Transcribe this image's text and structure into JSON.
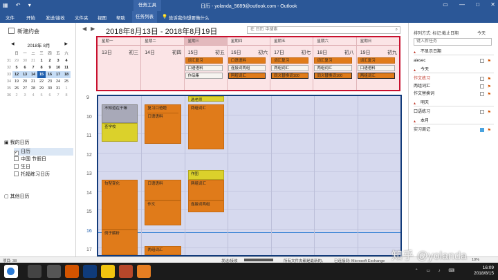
{
  "titlebar": {
    "context_tab": "任务工具",
    "window_title": "日历 - yolanda_5689@outlook.com - Outlook"
  },
  "ribbon": {
    "tabs": [
      "文件",
      "开始",
      "发送/接收",
      "文件夹",
      "视图",
      "帮助",
      "任务列表"
    ],
    "tell_me": "告诉我你想要做什么"
  },
  "left": {
    "new_appointment": "新建约会",
    "mini_cal_title": "2018年 8月",
    "dow": [
      "日",
      "一",
      "二",
      "三",
      "四",
      "五",
      "六"
    ],
    "weeks": [
      [
        "31",
        "29",
        "30",
        "31",
        "1",
        "2",
        "3",
        "4"
      ],
      [
        "32",
        "5",
        "6",
        "7",
        "8",
        "9",
        "10",
        "11"
      ],
      [
        "33",
        "12",
        "13",
        "14",
        "15",
        "16",
        "17",
        "18"
      ],
      [
        "34",
        "19",
        "20",
        "21",
        "22",
        "23",
        "24",
        "25"
      ],
      [
        "35",
        "26",
        "27",
        "28",
        "29",
        "30",
        "31",
        "1"
      ],
      [
        "36",
        "2",
        "3",
        "4",
        "5",
        "6",
        "7",
        "8"
      ]
    ],
    "my_calendars": "我的日历",
    "calendars": [
      "日历",
      "中国 节假日",
      "生日",
      "托福练习日历"
    ],
    "other_calendars": "其他日历"
  },
  "main": {
    "date_range": "2018年8月13日 - 2018年8月19日",
    "search_placeholder": "在 日历 中搜索",
    "days": [
      {
        "name": "星期一",
        "num": "13日",
        "lunar": "初三",
        "events": []
      },
      {
        "name": "星期二",
        "num": "14日",
        "lunar": "初四",
        "events": []
      },
      {
        "name": "星期三",
        "num": "15日",
        "lunar": "初五",
        "events": [
          "词汇复习",
          "口语语料",
          "作品集"
        ]
      },
      {
        "name": "星期四",
        "num": "16日",
        "lunar": "初六",
        "events": [
          "口语语料",
          "连接词两组",
          "阿纽词汇"
        ]
      },
      {
        "name": "星期五",
        "num": "17日",
        "lunar": "初七",
        "events": [
          "词汇复习",
          "两组词汇",
          "同义替换词100"
        ]
      },
      {
        "name": "星期六",
        "num": "18日",
        "lunar": "初八",
        "events": [
          "词汇复习",
          "两组词汇",
          "同义替换词100"
        ]
      },
      {
        "name": "星期日",
        "num": "19日",
        "lunar": "初九",
        "events": [
          "词汇复习",
          "口语语料",
          "两组词汇"
        ]
      }
    ],
    "hours": [
      "9",
      "10",
      "11",
      "12",
      "13",
      "14",
      "15",
      "16",
      "17"
    ],
    "grid_events": [
      {
        "label": "选老师",
        "day": 2,
        "start": 8.6,
        "end": 9.3,
        "color": "y"
      },
      {
        "label": "不知道在干嘛",
        "day": 0,
        "start": 9.45,
        "end": 10.4,
        "color": "g"
      },
      {
        "label": "查学校",
        "day": 0,
        "start": 10.4,
        "end": 11.4,
        "color": "y"
      },
      {
        "label": "复习口语题",
        "day": 1,
        "start": 9.45,
        "end": 11.5,
        "color": "o",
        "inner": "口语语料"
      },
      {
        "label": "两组词汇",
        "day": 2,
        "start": 9.45,
        "end": 11.8,
        "color": "o"
      },
      {
        "label": "作图",
        "day": 2,
        "start": 12.9,
        "end": 13.4,
        "color": "y"
      },
      {
        "label": "两组词汇",
        "day": 2,
        "start": 13.4,
        "end": 14.5,
        "color": "o"
      },
      {
        "label": "连接词两组",
        "day": 2,
        "start": 14.5,
        "end": 15.1,
        "color": "o"
      },
      {
        "label": "句型变化",
        "day": 0,
        "start": 13.4,
        "end": 16.0,
        "color": "o"
      },
      {
        "label": "口语语料",
        "day": 1,
        "start": 13.4,
        "end": 14.5,
        "color": "o"
      },
      {
        "label": "作文",
        "day": 1,
        "start": 14.5,
        "end": 15.8,
        "color": "o"
      },
      {
        "label": "例子解析",
        "day": 0,
        "start": 16.0,
        "end": 17.4,
        "color": "o"
      },
      {
        "label": "两组词汇",
        "day": 1,
        "start": 16.9,
        "end": 17.4,
        "color": "o"
      }
    ]
  },
  "right": {
    "sort_label": "排列方式: 标记:截止日期",
    "today_label": "今天",
    "new_task_placeholder": "键入新任务",
    "sections": [
      {
        "title": "不显示日期",
        "tasks": [
          {
            "label": "aiesec",
            "red": false
          }
        ]
      },
      {
        "title": "今天",
        "tasks": [
          {
            "label": "作文练习",
            "red": true
          },
          {
            "label": "两组词汇",
            "red": false
          },
          {
            "label": "作文替换词",
            "red": false
          }
        ]
      },
      {
        "title": "明天",
        "tasks": [
          {
            "label": "口语练习",
            "red": false
          }
        ]
      },
      {
        "title": "本月",
        "tasks": [
          {
            "label": "实习周记",
            "red": false
          }
        ]
      }
    ]
  },
  "statusbar": {
    "items_count": "项目: 38",
    "send_receive": "发送/接收",
    "status_text": "所有文件夹都是最新的。",
    "connected": "已连接到: Microsoft Exchange",
    "zoom": "10%"
  },
  "watermark": "知乎 @yolanda",
  "taskbar": {
    "time": "16:09",
    "date": "2018/8/15"
  }
}
